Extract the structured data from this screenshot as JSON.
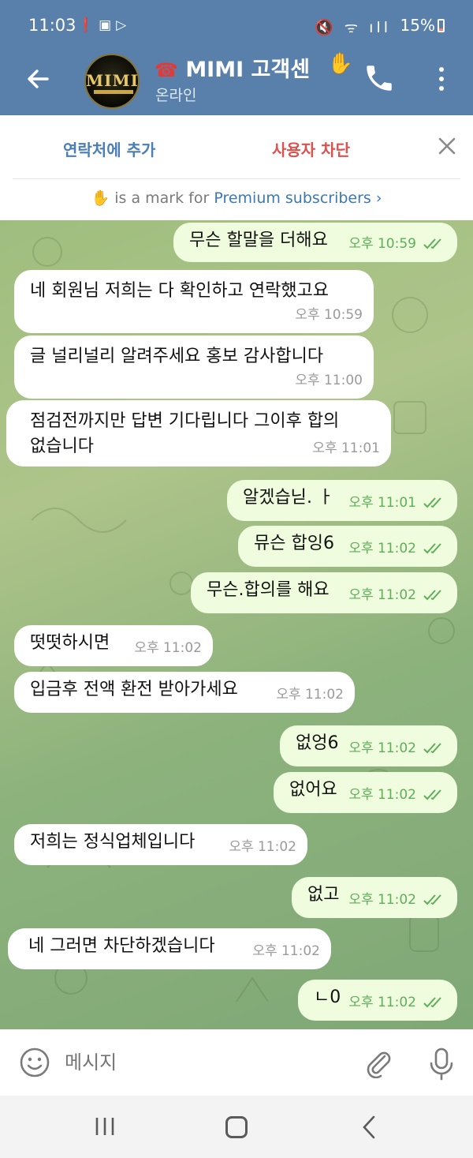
{
  "status_bar": {
    "time": "11:03",
    "battery": "15%"
  },
  "header": {
    "title": "MIMI 고객센",
    "avatar_text": "MIMI",
    "subtitle": "온라인",
    "icons": [
      "back-arrow-icon",
      "telephone-emoji",
      "waving-hand-emoji",
      "phone-icon",
      "more-vertical-icon"
    ]
  },
  "actions": {
    "add_contact": "연락처에 추가",
    "block_user": "사용자 차단"
  },
  "premium": {
    "prefix": "is a mark for",
    "link": "Premium subscribers",
    "chevron": "›"
  },
  "messages": [
    {
      "dir": "out",
      "text": "무슨 할말을 더해요",
      "time": "오후 10:59"
    },
    {
      "dir": "in",
      "text": "네 회원님 저희는 다 확인하고 연락했고요",
      "time": "오후 10:59"
    },
    {
      "dir": "in",
      "text": "글 널리널리 알려주세요  홍보 감사합니다",
      "time": "오후 11:00"
    },
    {
      "dir": "in",
      "text": "점검전까지만 답변 기다립니다 그이후 합의",
      "text2": "없습니다",
      "time": "오후 11:01"
    },
    {
      "dir": "out",
      "text": "알겠습닏. ㅏ",
      "time": "오후 11:01"
    },
    {
      "dir": "out",
      "text": "뮤슨 합잉6",
      "time": "오후 11:02"
    },
    {
      "dir": "out",
      "text": "무슨.합의를 해요",
      "time": "오후 11:02"
    },
    {
      "dir": "in",
      "text": "떳떳하시면",
      "time": "오후 11:02"
    },
    {
      "dir": "in",
      "text": "입금후 전액 환전 받아가세요",
      "time": "오후 11:02"
    },
    {
      "dir": "out",
      "text": "없엉6",
      "time": "오후 11:02"
    },
    {
      "dir": "out",
      "text": "없어요",
      "time": "오후 11:02"
    },
    {
      "dir": "in",
      "text": "저희는 정식업체입니다",
      "time": "오후 11:02"
    },
    {
      "dir": "out",
      "text": "없고",
      "time": "오후 11:02"
    },
    {
      "dir": "in",
      "text": "네 그러면 차단하겠습니다",
      "time": "오후 11:02"
    },
    {
      "dir": "out",
      "text": "ㄴ0",
      "time": "오후 11:02"
    }
  ],
  "composer": {
    "placeholder": "메시지"
  },
  "colors": {
    "header": "#5880ab",
    "outgoing_bubble": "#effdde",
    "incoming_bubble": "#ffffff",
    "read_ticks": "#5fae5a",
    "block_red": "#d9534f",
    "link_blue": "#3a78b8"
  }
}
